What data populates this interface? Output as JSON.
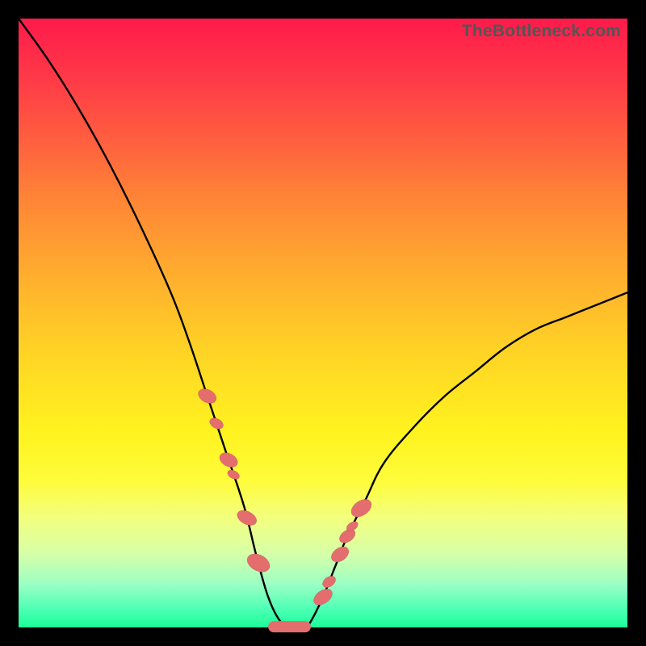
{
  "watermark": "TheBottleneck.com",
  "colors": {
    "frame": "#000000",
    "curve": "#000000",
    "marker": "#e46d6d"
  },
  "chart_data": {
    "type": "line",
    "title": "",
    "xlabel": "",
    "ylabel": "",
    "xlim": [
      0,
      100
    ],
    "ylim": [
      0,
      100
    ],
    "grid": false,
    "legend": false,
    "notes": "V-shaped bottleneck curve over rainbow vertical gradient. Y ~ distance of x from optimum ~44; minimum (~0) in flat region x∈[41,48]; left branch rises to ~100 at x=0; right branch rises to ~55 at x=100. Axes unlabeled; values estimated from pixel positions.",
    "series": [
      {
        "name": "bottleneck-curve",
        "x": [
          0,
          5,
          10,
          15,
          20,
          25,
          28,
          31,
          34,
          37,
          39,
          41,
          43,
          45,
          47,
          48,
          50,
          52,
          54,
          57,
          60,
          65,
          70,
          75,
          80,
          85,
          90,
          95,
          100
        ],
        "y": [
          100,
          93,
          85,
          76,
          66,
          55,
          47,
          38,
          29,
          20,
          12,
          5,
          1,
          0,
          0,
          1,
          5,
          10,
          15,
          21,
          27,
          33,
          38,
          42,
          46,
          49,
          51,
          53,
          55
        ]
      }
    ],
    "markers": {
      "left_cluster_x": [
        31.0,
        32.5,
        34.5,
        35.3,
        37.5,
        39.4
      ],
      "right_cluster_x": [
        50.0,
        51.0,
        52.8,
        54.0,
        54.8,
        56.3
      ],
      "flat_segment_x": [
        41.0,
        48.0
      ]
    },
    "gradient_stops": [
      {
        "pos": 0.0,
        "color": "#ff1a4b"
      },
      {
        "pos": 0.3,
        "color": "#ff8636"
      },
      {
        "pos": 0.55,
        "color": "#ffd425"
      },
      {
        "pos": 0.76,
        "color": "#fefc3b"
      },
      {
        "pos": 0.93,
        "color": "#9affc4"
      },
      {
        "pos": 1.0,
        "color": "#1aff98"
      }
    ]
  }
}
